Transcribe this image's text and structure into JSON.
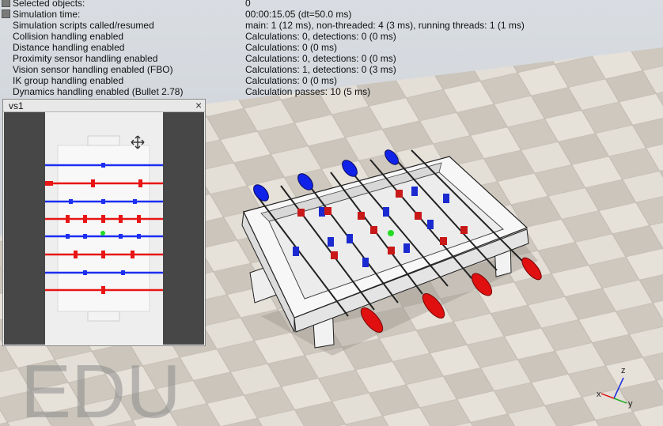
{
  "info_panel": {
    "rows": [
      {
        "label": "Selected objects:",
        "value": "0"
      },
      {
        "label": "Simulation time:",
        "value": "00:00:15.05 (dt=50.0 ms)"
      },
      {
        "label": "Simulation scripts called/resumed",
        "value": "main: 1 (12 ms), non-threaded: 4 (3 ms), running threads: 1 (1 ms)"
      },
      {
        "label": "Collision handling enabled",
        "value": "Calculations: 0, detections: 0 (0 ms)"
      },
      {
        "label": "Distance handling enabled",
        "value": "Calculations: 0 (0 ms)"
      },
      {
        "label": "Proximity sensor handling enabled",
        "value": "Calculations: 0, detections: 0 (0 ms)"
      },
      {
        "label": "Vision sensor handling enabled (FBO)",
        "value": "Calculations: 1, detections: 0 (3 ms)"
      },
      {
        "label": "IK group handling enabled",
        "value": "Calculations: 0 (0 ms)"
      },
      {
        "label": "Dynamics handling enabled (Bullet 2.78)",
        "value": "Calculation passes: 10 (5 ms)"
      }
    ]
  },
  "vision_window": {
    "title": "vs1",
    "close": "×"
  },
  "watermark": "EDU",
  "axes": {
    "x": "x",
    "y": "y",
    "z": "z"
  },
  "colors": {
    "red_team": "#e01010",
    "blue_team": "#1030e0",
    "ball": "#22dd22",
    "floor_light": "#e2ddd5",
    "floor_dark": "#c8c2b8"
  }
}
